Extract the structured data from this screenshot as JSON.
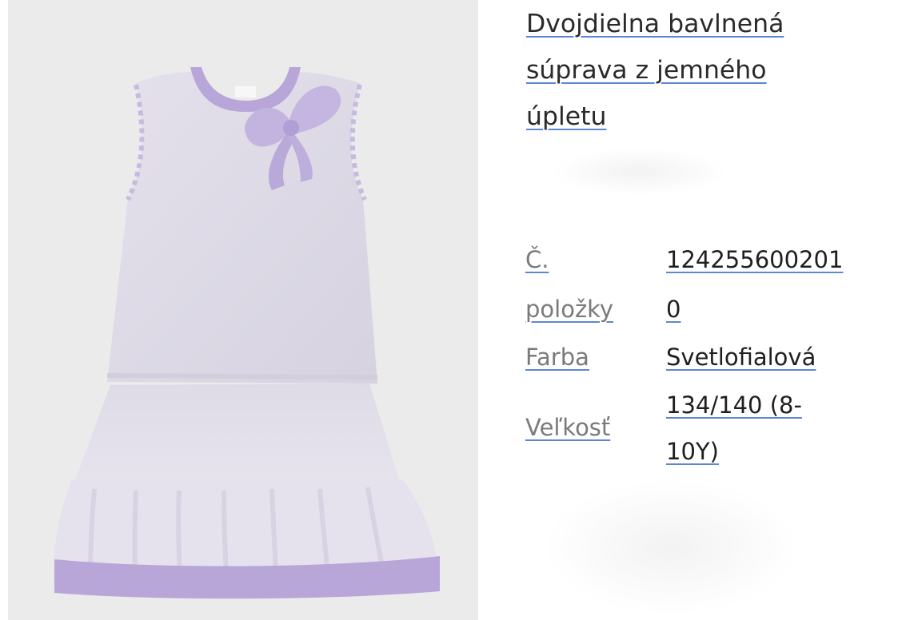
{
  "product": {
    "title_lines": [
      "Dvojdielna bavlnená",
      "súprava z jemného",
      "úpletu"
    ],
    "details": {
      "item_no": {
        "label_lines": [
          "Č.",
          "položky"
        ],
        "value_lines": [
          "124255600201",
          "0"
        ]
      },
      "color": {
        "label": "Farba",
        "value": "Svetlofialová"
      },
      "size": {
        "label": "Veľkosť",
        "value_lines": [
          "134/140 (8-",
          "10Y)"
        ]
      }
    }
  },
  "image": {
    "icon": "lilac-knit-top-and-skirt-set",
    "colors": {
      "background": "#ebebeb",
      "garment": "#dedbe6",
      "trim": "#b8a6d8",
      "link_underline": "#5c86d4"
    }
  }
}
